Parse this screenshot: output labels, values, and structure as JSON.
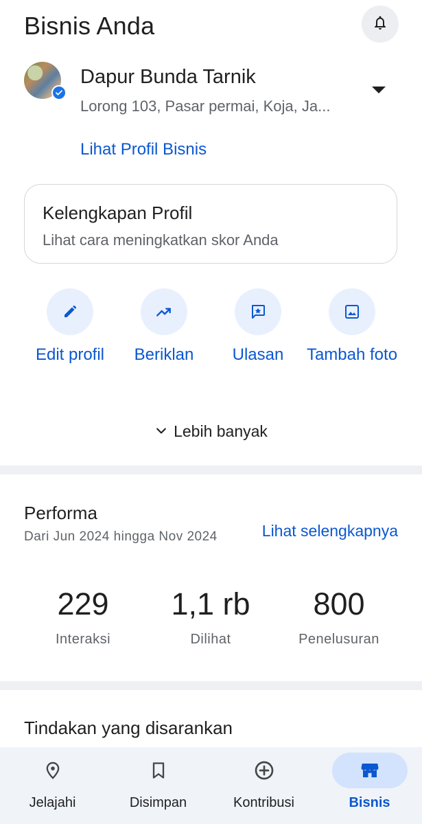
{
  "header": {
    "title": "Bisnis Anda"
  },
  "business": {
    "name": "Dapur Bunda Tarnik",
    "address": "Lorong 103, Pasar permai, Koja, Ja...",
    "profile_link": "Lihat Profil Bisnis"
  },
  "profile_card": {
    "title": "Kelengkapan Profil",
    "subtitle": "Lihat cara meningkatkan skor Anda"
  },
  "actions": [
    {
      "label": "Edit profil",
      "icon": "pencil-icon"
    },
    {
      "label": "Beriklan",
      "icon": "trending-up-icon"
    },
    {
      "label": "Ulasan",
      "icon": "review-star-icon"
    },
    {
      "label": "Tambah foto",
      "icon": "image-icon"
    }
  ],
  "more": {
    "label": "Lebih banyak"
  },
  "performance": {
    "title": "Performa",
    "range": "Dari Jun 2024 hingga Nov 2024",
    "link": "Lihat selengkapnya",
    "stats": [
      {
        "value": "229",
        "label": "Interaksi"
      },
      {
        "value": "1,1 rb",
        "label": "Dilihat"
      },
      {
        "value": "800",
        "label": "Penelusuran"
      }
    ]
  },
  "suggestions": {
    "title": "Tindakan yang disarankan"
  },
  "bottom_nav": [
    {
      "label": "Jelajahi",
      "icon": "location-pin-icon"
    },
    {
      "label": "Disimpan",
      "icon": "bookmark-icon"
    },
    {
      "label": "Kontribusi",
      "icon": "add-circle-icon"
    },
    {
      "label": "Bisnis",
      "icon": "storefront-icon",
      "active": true
    }
  ],
  "colors": {
    "accent": "#0b57d0",
    "accent_bg": "#e8f0fe",
    "nav_active_bg": "#d3e3fd"
  }
}
